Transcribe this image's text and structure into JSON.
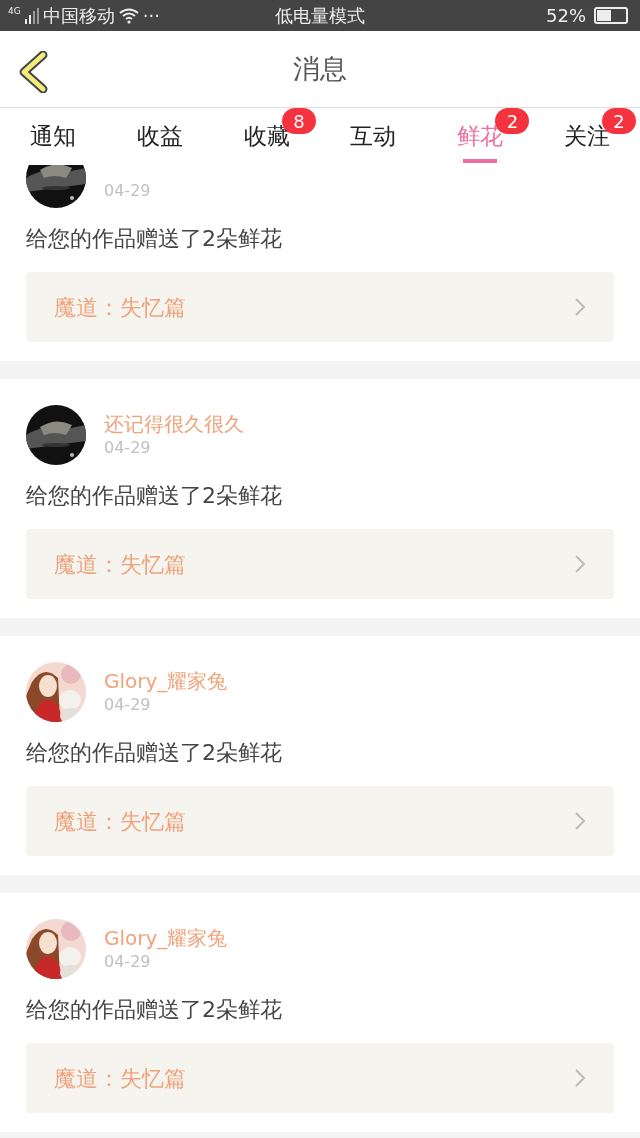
{
  "status_bar": {
    "carrier": "中国移动",
    "network": "4G",
    "dots": "···",
    "mode": "低电量模式",
    "battery": "52%"
  },
  "header": {
    "title": "消息"
  },
  "tabs": [
    {
      "label": "通知",
      "selected": false
    },
    {
      "label": "收益",
      "selected": false
    },
    {
      "label": "收藏",
      "selected": false,
      "badge": "8"
    },
    {
      "label": "互动",
      "selected": false
    },
    {
      "label": "鲜花",
      "selected": true,
      "badge": "2"
    },
    {
      "label": "关注",
      "selected": false,
      "badge": "2"
    }
  ],
  "messages": [
    {
      "date": "04-29",
      "text": "给您的作品赠送了2朵鲜花",
      "book": "魔道：失忆篇"
    },
    {
      "user": "还记得很久很久",
      "date": "04-29",
      "text": "给您的作品赠送了2朵鲜花",
      "book": "魔道：失忆篇"
    },
    {
      "user": "Glory_耀家兔",
      "date": "04-29",
      "text": "给您的作品赠送了2朵鲜花",
      "book": "魔道：失忆篇"
    },
    {
      "user": "Glory_耀家兔",
      "date": "04-29",
      "text": "给您的作品赠送了2朵鲜花",
      "book": "魔道：失忆篇"
    }
  ]
}
